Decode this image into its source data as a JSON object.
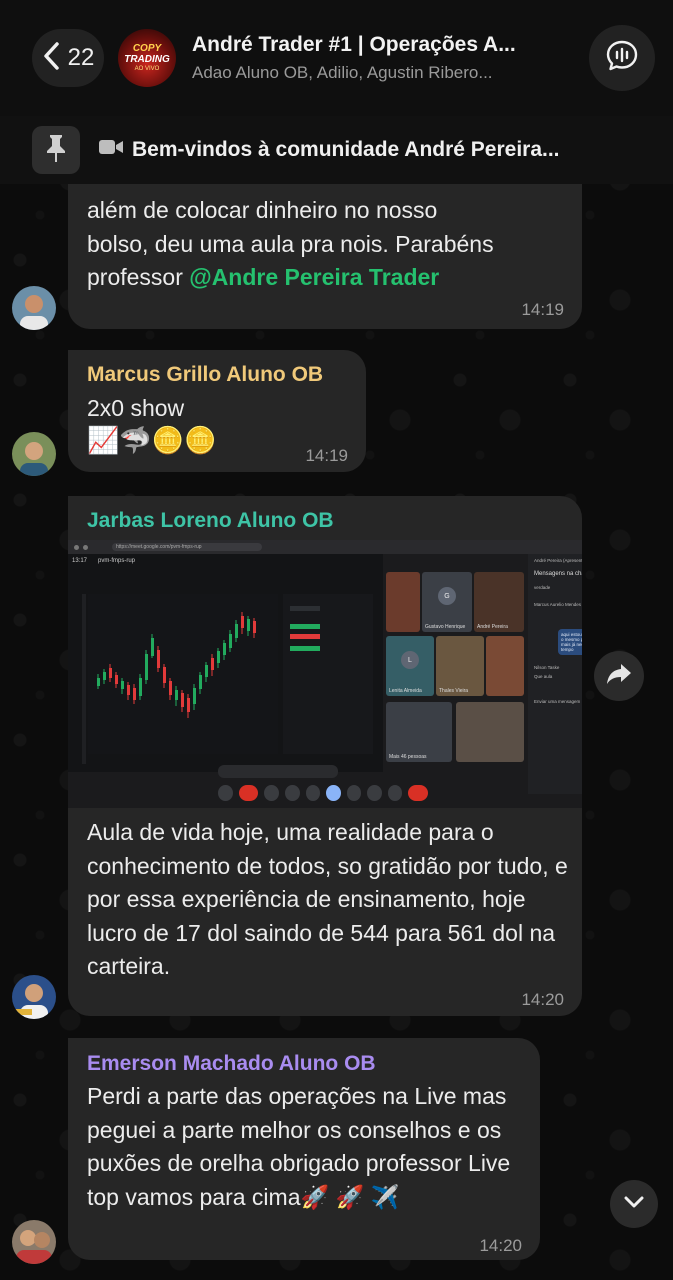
{
  "header": {
    "back_count": "22",
    "title": "André Trader #1 | Operações A...",
    "subtitle": "Adao Aluno OB, Adilio, Agustin Ribero...",
    "group_avatar_text": [
      "COPY",
      "TRADING",
      "AO VIVO"
    ]
  },
  "pinned": {
    "text": "Bem-vindos à comunidade André Pereira..."
  },
  "messages": [
    {
      "sender": "",
      "lines": [
        "além de colocar dinheiro no nosso",
        "bolso, deu uma aula pra nois. Parabéns",
        "professor "
      ],
      "mention": "@Andre Pereira Trader",
      "time": "14:19"
    },
    {
      "sender": "Marcus Grillo Aluno OB",
      "sender_color": "#f0c97a",
      "text": "2x0 show",
      "emojis": "📈🦈🪙🪙",
      "time": "14:19"
    },
    {
      "sender": "Jarbas Loreno Aluno OB",
      "sender_color": "#3ec4a6",
      "text": "Aula de vida hoje, uma realidade para o conhecimento de todos, so gratidão por tudo, e por essa experiência de ensinamento, hoje lucro de 17 dol saindo de 544 para 561 dol na carteira.",
      "time": "14:20",
      "image": {
        "url": "https://meet.google.com/pvm-fmps-rup",
        "meeting_code": "pvm-fmps-rup",
        "time_label": "13:17",
        "panel_title": "Mensagens na chamada",
        "presenter": "André Pereira (Apresentando)",
        "participants": [
          "Gustavo Henrique",
          "André Pereira",
          "Lenita Almeida",
          "Thales Vieira",
          "Mais 46 pessoas"
        ],
        "chat_items": [
          "verdade",
          "Marcus Aurelio Mendes Grillo",
          "aqui estou com novas amizades como o mesmo pensamento mesmo distantes mais já nem acho que conheço a muito tempo",
          "Nilson Taske",
          "Que aula"
        ],
        "input_placeholder": "Enviar uma mensagem"
      }
    },
    {
      "sender": "Emerson Machado Aluno OB",
      "sender_color": "#a98cf0",
      "text": "Perdi a parte das operações na Live mas peguei a parte melhor os conselhos e os puxões de orelha obrigado professor Live top vamos para cima",
      "emojis": "🚀 🚀 ✈️",
      "time": "14:20"
    }
  ],
  "icons": {
    "back": "chevron-left-icon",
    "call": "voice-chat-icon",
    "pin": "pin-icon",
    "video": "video-camera-icon",
    "forward": "forward-icon",
    "scroll_down": "chevron-down-icon"
  },
  "colors": {
    "bubble": "#262626",
    "mention": "#25c16f",
    "background": "#0b0b0b"
  }
}
